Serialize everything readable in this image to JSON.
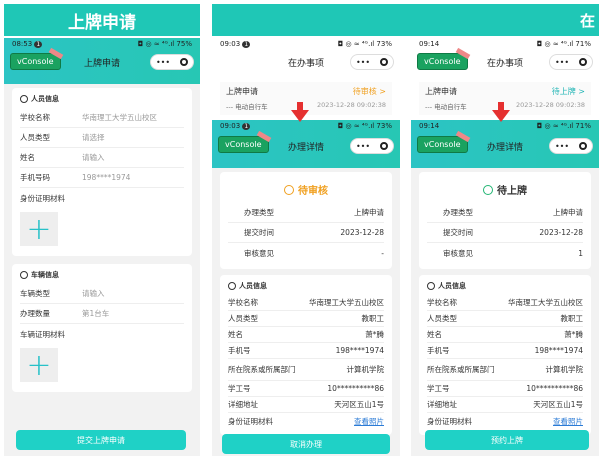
{
  "panel1": {
    "banner": "上牌申请",
    "status_time": "08:53",
    "status_badge": "1",
    "status_right": "◘ ◎ ≈ ⁴ᴳ.ıl 75%",
    "vconsole": "vConsole",
    "title": "上牌申请",
    "cap_more": "•••",
    "person_title": "人员信息",
    "person_rows": [
      {
        "label": "学校名称",
        "value": "华南理工大学五山校区"
      },
      {
        "label": "人员类型",
        "value": "请选择"
      },
      {
        "label": "姓名",
        "value": "请输入"
      },
      {
        "label": "手机号码",
        "value": "198****1974"
      },
      {
        "label": "身份证明材料",
        "value": ""
      }
    ],
    "vehicle_title": "车辆信息",
    "vehicle_rows": [
      {
        "label": "车辆类型",
        "value": "请输入"
      },
      {
        "label": "办理数量",
        "value": "第1台车"
      },
      {
        "label": "车辆证明材料",
        "value": ""
      }
    ],
    "submit": "提交上牌申请"
  },
  "panel2": {
    "status_time": "09:03",
    "status_badge": "1",
    "status_right": "◘ ◎ ≈ ⁴ᴳ.ıl 73%",
    "title": "在办事项",
    "item_title": "上牌申请",
    "item_status": "待审核 >",
    "item_sub": "--- 电动自行车",
    "item_time": "2023-12-28 09:02:38",
    "detail_status_time": "09:03",
    "detail_badge": "1",
    "detail_status_right": "◘ ◎ ≈ ⁴ᴳ.ıl 73%",
    "vconsole": "vConsole",
    "detail_title": "办理详情",
    "cap_more": "•••",
    "state": "待审核",
    "state_color": "#f0a020",
    "summary_rows": [
      {
        "label": "办理类型",
        "value": "上牌申请"
      },
      {
        "label": "提交时间",
        "value": "2023-12-28"
      },
      {
        "label": "审核意见",
        "value": "-"
      }
    ],
    "person_title": "人员信息",
    "person_rows": [
      {
        "label": "学校名称",
        "value": "华南理工大学五山校区"
      },
      {
        "label": "人员类型",
        "value": "教职工"
      },
      {
        "label": "姓名",
        "value": "萧*腾"
      },
      {
        "label": "手机号",
        "value": "198****1974"
      },
      {
        "label": "所在院系或所属部门",
        "value": "计算机学院"
      },
      {
        "label": "学工号",
        "value": "10**********86"
      },
      {
        "label": "详细地址",
        "value": "天河区五山1号"
      },
      {
        "label": "身份证明材料",
        "value": "查看照片"
      }
    ],
    "button": "取消办理"
  },
  "panel3": {
    "status_time": "09:14",
    "status_right": "◘ ◎ ≈ ⁴ᴳ.ıl 71%",
    "vconsole": "vConsole",
    "title": "在办事项",
    "item_title": "上牌申请",
    "item_status": "待上牌 >",
    "item_sub": "--- 电动自行车",
    "item_time": "2023-12-28 09:02:38",
    "detail_status_time": "09:14",
    "detail_status_right": "◘ ◎ ≈ ⁴ᴳ.ıl 71%",
    "detail_title": "办理详情",
    "cap_more": "•••",
    "state": "待上牌",
    "state_color": "#22b573",
    "summary_rows": [
      {
        "label": "办理类型",
        "value": "上牌申请"
      },
      {
        "label": "提交时间",
        "value": "2023-12-28"
      },
      {
        "label": "审核意见",
        "value": "1"
      }
    ],
    "person_title": "人员信息",
    "person_rows": [
      {
        "label": "学校名称",
        "value": "华南理工大学五山校区"
      },
      {
        "label": "人员类型",
        "value": "教职工"
      },
      {
        "label": "姓名",
        "value": "萧*腾"
      },
      {
        "label": "手机号",
        "value": "198****1974"
      },
      {
        "label": "所在院系或所属部门",
        "value": "计算机学院"
      },
      {
        "label": "学工号",
        "value": "10**********86"
      },
      {
        "label": "详细地址",
        "value": "天河区五山1号"
      },
      {
        "label": "身份证明材料",
        "value": "查看照片"
      }
    ],
    "button": "预约上牌",
    "banner_fragment": "在"
  }
}
